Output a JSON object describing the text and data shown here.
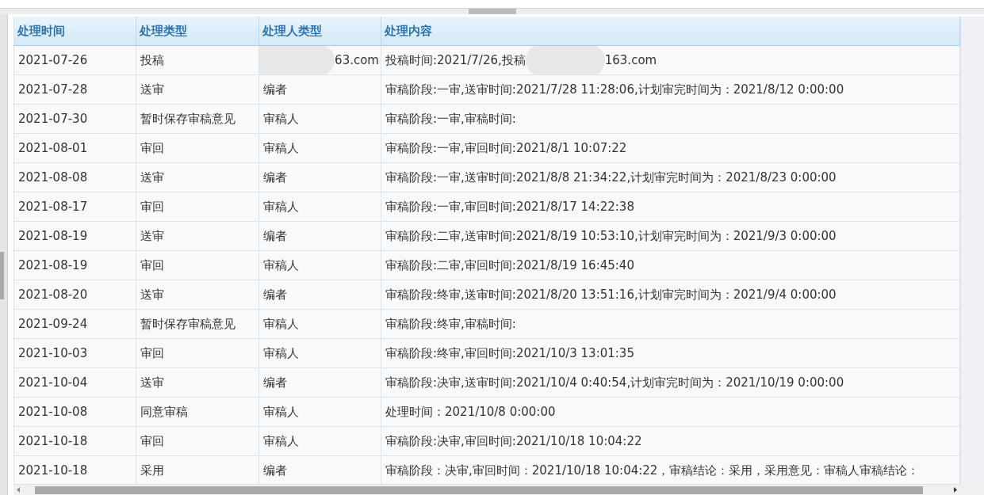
{
  "table": {
    "columns": [
      "处理时间",
      "处理类型",
      "处理人类型",
      "处理内容"
    ],
    "rows": [
      {
        "date": "2021-07-26",
        "type": "投稿",
        "role": "63.com",
        "content": "投稿时间:2021/7/26,投稿",
        "content_tail": "163.com",
        "redacted": true
      },
      {
        "date": "2021-07-28",
        "type": "送审",
        "role": "编者",
        "content": "审稿阶段:一审,送审时间:2021/7/28 11:28:06,计划审完时间为：2021/8/12 0:00:00",
        "redacted": false
      },
      {
        "date": "2021-07-30",
        "type": "暂时保存审稿意见",
        "role": "审稿人",
        "content": "审稿阶段:一审,审稿时间:",
        "redacted": false
      },
      {
        "date": "2021-08-01",
        "type": "审回",
        "role": "审稿人",
        "content": "审稿阶段:一审,审回时间:2021/8/1 10:07:22",
        "redacted": false
      },
      {
        "date": "2021-08-08",
        "type": "送审",
        "role": "编者",
        "content": "审稿阶段:一审,送审时间:2021/8/8 21:34:22,计划审完时间为：2021/8/23 0:00:00",
        "redacted": false
      },
      {
        "date": "2021-08-17",
        "type": "审回",
        "role": "审稿人",
        "content": "审稿阶段:一审,审回时间:2021/8/17 14:22:38",
        "redacted": false
      },
      {
        "date": "2021-08-19",
        "type": "送审",
        "role": "编者",
        "content": "审稿阶段:二审,送审时间:2021/8/19 10:53:10,计划审完时间为：2021/9/3 0:00:00",
        "redacted": false
      },
      {
        "date": "2021-08-19",
        "type": "审回",
        "role": "审稿人",
        "content": "审稿阶段:二审,审回时间:2021/8/19 16:45:40",
        "redacted": false
      },
      {
        "date": "2021-08-20",
        "type": "送审",
        "role": "编者",
        "content": "审稿阶段:终审,送审时间:2021/8/20 13:51:16,计划审完时间为：2021/9/4 0:00:00",
        "redacted": false
      },
      {
        "date": "2021-09-24",
        "type": "暂时保存审稿意见",
        "role": "审稿人",
        "content": "审稿阶段:终审,审稿时间:",
        "redacted": false
      },
      {
        "date": "2021-10-03",
        "type": "审回",
        "role": "审稿人",
        "content": "审稿阶段:终审,审回时间:2021/10/3 13:01:35",
        "redacted": false
      },
      {
        "date": "2021-10-04",
        "type": "送审",
        "role": "编者",
        "content": "审稿阶段:决审,送审时间:2021/10/4 0:40:54,计划审完时间为：2021/10/19 0:00:00",
        "redacted": false
      },
      {
        "date": "2021-10-08",
        "type": "同意审稿",
        "role": "审稿人",
        "content": "处理时间：2021/10/8 0:00:00",
        "redacted": false
      },
      {
        "date": "2021-10-18",
        "type": "审回",
        "role": "审稿人",
        "content": "审稿阶段:决审,审回时间:2021/10/18 10:04:22",
        "redacted": false
      },
      {
        "date": "2021-10-18",
        "type": "采用",
        "role": "编者",
        "content": "审稿阶段：决审,审回时间：2021/10/18 10:04:22，审稿结论：采用，采用意见：审稿人审稿结论：",
        "redacted": false
      }
    ]
  }
}
